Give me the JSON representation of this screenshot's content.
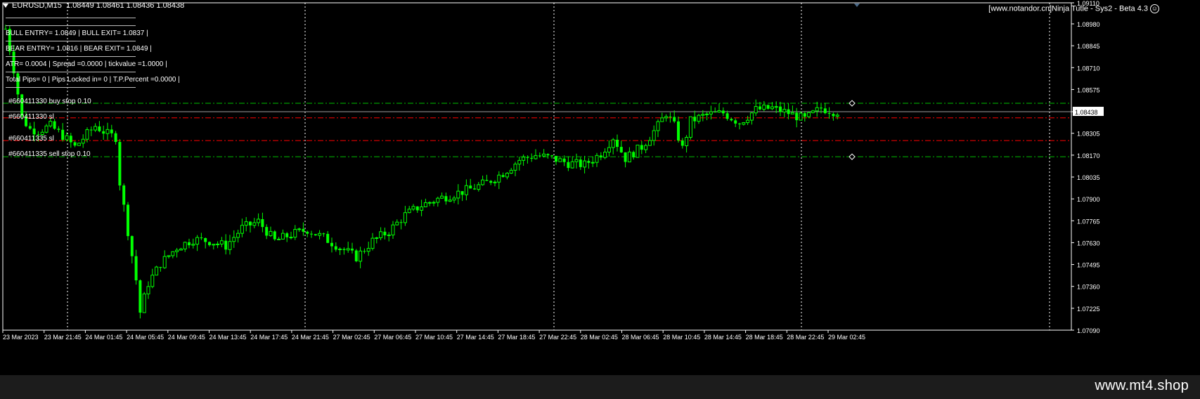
{
  "header": {
    "symbol_line": "EURUSD,M15  1.08449 1.08461 1.08436 1.08438",
    "indicator_label": "[www.notandor.cn]Ninja Tutle - Sys2 - Beta 4.3"
  },
  "info_panel": {
    "bull_line": "BULL ENTRY= 1.0849 | BULL EXIT= 1.0837 |",
    "bear_line": "BEAR ENTRY= 1.0816 | BEAR EXIT= 1.0849 |",
    "atr_line": "ATR= 0.0004 | Spread =0.0000 | tickvalue =1.0000 |",
    "pips_line": "Total Pips= 0 | Pips Locked in= 0 | T.P.Percent =0.0000 |"
  },
  "orders": {
    "buy_stop": "#660411330 buy stop 0.10",
    "sl_upper": "#660411330 sl",
    "sl_lower": "#660411335 sl",
    "sell_stop": "#660411335 sell stop 0.10"
  },
  "watermark": "www.mt4.shop",
  "colors": {
    "background": "#000000",
    "candle": "#00ff00",
    "grid": "#ffffff",
    "buy_level": "#00c000",
    "sl_level": "#ff0000",
    "bid_line": "#a0a0a0"
  },
  "chart_data": {
    "type": "candlestick",
    "symbol": "EURUSD",
    "timeframe": "M15",
    "last_price": 1.08438,
    "ylim": [
      1.0709,
      1.0911
    ],
    "y_ticks": [
      "1.09110",
      "1.08980",
      "1.08845",
      "1.08710",
      "1.08575",
      "1.08438",
      "1.08305",
      "1.08170",
      "1.08035",
      "1.07900",
      "1.07765",
      "1.07630",
      "1.07495",
      "1.07360",
      "1.07225",
      "1.07090"
    ],
    "x_ticks": [
      "23 Mar 2023",
      "23 Mar 21:45",
      "24 Mar 01:45",
      "24 Mar 05:45",
      "24 Mar 09:45",
      "24 Mar 13:45",
      "24 Mar 17:45",
      "24 Mar 21:45",
      "27 Mar 02:45",
      "27 Mar 06:45",
      "27 Mar 10:45",
      "27 Mar 14:45",
      "27 Mar 18:45",
      "27 Mar 22:45",
      "28 Mar 02:45",
      "28 Mar 06:45",
      "28 Mar 10:45",
      "28 Mar 14:45",
      "28 Mar 18:45",
      "28 Mar 22:45",
      "29 Mar 02:45"
    ],
    "levels": [
      {
        "name": "buy stop",
        "price": 1.0849
      },
      {
        "name": "sl",
        "price": 1.084
      },
      {
        "name": "sl",
        "price": 1.0826
      },
      {
        "name": "sell stop",
        "price": 1.0816
      }
    ],
    "close_path": [
      [
        0,
        1.0895
      ],
      [
        2,
        1.087
      ],
      [
        4,
        1.084
      ],
      [
        6,
        1.0833
      ],
      [
        8,
        1.0832
      ],
      [
        11,
        1.0835
      ],
      [
        14,
        1.0829
      ],
      [
        17,
        1.0822
      ],
      [
        20,
        1.083
      ],
      [
        22,
        1.0835
      ],
      [
        25,
        1.083
      ],
      [
        27,
        1.0828
      ],
      [
        28,
        1.08
      ],
      [
        30,
        1.077
      ],
      [
        32,
        1.074
      ],
      [
        33,
        1.072
      ],
      [
        35,
        1.0738
      ],
      [
        38,
        1.075
      ],
      [
        42,
        1.076
      ],
      [
        46,
        1.0765
      ],
      [
        50,
        1.0764
      ],
      [
        54,
        1.0761
      ],
      [
        58,
        1.0772
      ],
      [
        62,
        1.0776
      ],
      [
        66,
        1.0764
      ],
      [
        70,
        1.0768
      ],
      [
        74,
        1.0771
      ],
      [
        78,
        1.0766
      ],
      [
        82,
        1.076
      ],
      [
        86,
        1.0754
      ],
      [
        90,
        1.0764
      ],
      [
        94,
        1.077
      ],
      [
        98,
        1.078
      ],
      [
        102,
        1.0786
      ],
      [
        106,
        1.079
      ],
      [
        110,
        1.0793
      ],
      [
        114,
        1.0796
      ],
      [
        118,
        1.08
      ],
      [
        122,
        1.0806
      ],
      [
        126,
        1.0814
      ],
      [
        130,
        1.0817
      ],
      [
        134,
        1.0815
      ],
      [
        138,
        1.0812
      ],
      [
        142,
        1.0811
      ],
      [
        146,
        1.0818
      ],
      [
        149,
        1.0828
      ],
      [
        152,
        1.0815
      ],
      [
        156,
        1.0822
      ],
      [
        160,
        1.0835
      ],
      [
        162,
        1.0843
      ],
      [
        164,
        1.0835
      ],
      [
        166,
        1.0821
      ],
      [
        168,
        1.0838
      ],
      [
        172,
        1.0842
      ],
      [
        176,
        1.0843
      ],
      [
        180,
        1.0837
      ],
      [
        184,
        1.0845
      ],
      [
        188,
        1.0846
      ],
      [
        192,
        1.0843
      ],
      [
        196,
        1.0839
      ],
      [
        200,
        1.0846
      ],
      [
        203,
        1.0844
      ]
    ]
  }
}
